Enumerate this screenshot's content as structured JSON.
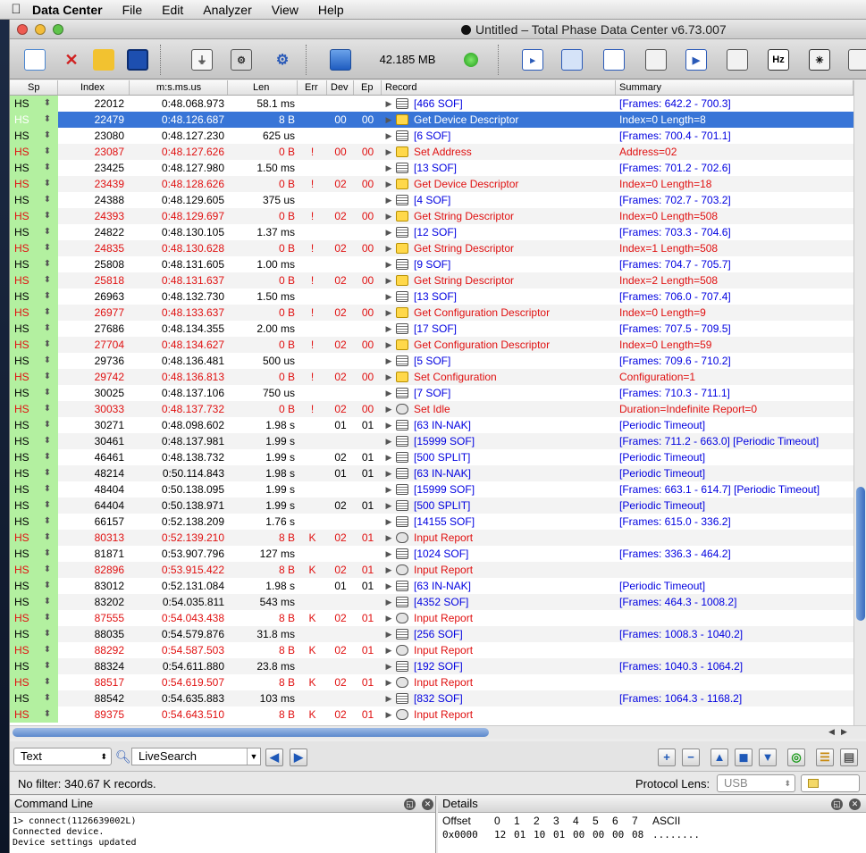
{
  "menubar": {
    "app": "Data Center",
    "items": [
      "File",
      "Edit",
      "Analyzer",
      "View",
      "Help"
    ]
  },
  "window": {
    "title": "Untitled – Total Phase Data Center v6.73.007"
  },
  "toolbar": {
    "memory": "42.185 MB",
    "hz_label": "Hz"
  },
  "columns": [
    "Sp",
    "Index",
    "m:s.ms.us",
    "Len",
    "Err",
    "Dev",
    "Ep",
    "Record",
    "Summary"
  ],
  "rows": [
    {
      "sp": "HS",
      "idx": "22012",
      "time": "0:48.068.973",
      "len": "58.1 ms",
      "err": "",
      "dev": "",
      "ep": "",
      "rec": "[466 SOF]",
      "icon": "sof",
      "sum": "[Frames: 642.2 - 700.3]",
      "red": false,
      "sel": false
    },
    {
      "sp": "HS",
      "idx": "22479",
      "time": "0:48.126.687",
      "len": "8 B",
      "err": "",
      "dev": "00",
      "ep": "00",
      "rec": "Get Device Descriptor",
      "icon": "ctrl",
      "sum": "Index=0 Length=8",
      "red": false,
      "sel": true
    },
    {
      "sp": "HS",
      "idx": "23080",
      "time": "0:48.127.230",
      "len": "625 us",
      "err": "",
      "dev": "",
      "ep": "",
      "rec": "[6 SOF]",
      "icon": "sof",
      "sum": "[Frames: 700.4 - 701.1]",
      "red": false,
      "sel": false
    },
    {
      "sp": "HS",
      "idx": "23087",
      "time": "0:48.127.626",
      "len": "0 B",
      "err": "!",
      "dev": "00",
      "ep": "00",
      "rec": "Set Address",
      "icon": "ctrl",
      "sum": "Address=02",
      "red": true,
      "sel": false
    },
    {
      "sp": "HS",
      "idx": "23425",
      "time": "0:48.127.980",
      "len": "1.50 ms",
      "err": "",
      "dev": "",
      "ep": "",
      "rec": "[13 SOF]",
      "icon": "sof",
      "sum": "[Frames: 701.2 - 702.6]",
      "red": false,
      "sel": false
    },
    {
      "sp": "HS",
      "idx": "23439",
      "time": "0:48.128.626",
      "len": "0 B",
      "err": "!",
      "dev": "02",
      "ep": "00",
      "rec": "Get Device Descriptor",
      "icon": "ctrl",
      "sum": "Index=0 Length=18",
      "red": true,
      "sel": false
    },
    {
      "sp": "HS",
      "idx": "24388",
      "time": "0:48.129.605",
      "len": "375 us",
      "err": "",
      "dev": "",
      "ep": "",
      "rec": "[4 SOF]",
      "icon": "sof",
      "sum": "[Frames: 702.7 - 703.2]",
      "red": false,
      "sel": false
    },
    {
      "sp": "HS",
      "idx": "24393",
      "time": "0:48.129.697",
      "len": "0 B",
      "err": "!",
      "dev": "02",
      "ep": "00",
      "rec": "Get String Descriptor",
      "icon": "ctrl",
      "sum": "Index=0 Length=508",
      "red": true,
      "sel": false
    },
    {
      "sp": "HS",
      "idx": "24822",
      "time": "0:48.130.105",
      "len": "1.37 ms",
      "err": "",
      "dev": "",
      "ep": "",
      "rec": "[12 SOF]",
      "icon": "sof",
      "sum": "[Frames: 703.3 - 704.6]",
      "red": false,
      "sel": false
    },
    {
      "sp": "HS",
      "idx": "24835",
      "time": "0:48.130.628",
      "len": "0 B",
      "err": "!",
      "dev": "02",
      "ep": "00",
      "rec": "Get String Descriptor",
      "icon": "ctrl",
      "sum": "Index=1 Length=508",
      "red": true,
      "sel": false
    },
    {
      "sp": "HS",
      "idx": "25808",
      "time": "0:48.131.605",
      "len": "1.00 ms",
      "err": "",
      "dev": "",
      "ep": "",
      "rec": "[9 SOF]",
      "icon": "sof",
      "sum": "[Frames: 704.7 - 705.7]",
      "red": false,
      "sel": false
    },
    {
      "sp": "HS",
      "idx": "25818",
      "time": "0:48.131.637",
      "len": "0 B",
      "err": "!",
      "dev": "02",
      "ep": "00",
      "rec": "Get String Descriptor",
      "icon": "ctrl",
      "sum": "Index=2 Length=508",
      "red": true,
      "sel": false
    },
    {
      "sp": "HS",
      "idx": "26963",
      "time": "0:48.132.730",
      "len": "1.50 ms",
      "err": "",
      "dev": "",
      "ep": "",
      "rec": "[13 SOF]",
      "icon": "sof",
      "sum": "[Frames: 706.0 - 707.4]",
      "red": false,
      "sel": false
    },
    {
      "sp": "HS",
      "idx": "26977",
      "time": "0:48.133.637",
      "len": "0 B",
      "err": "!",
      "dev": "02",
      "ep": "00",
      "rec": "Get Configuration Descriptor",
      "icon": "ctrl",
      "sum": "Index=0 Length=9",
      "red": true,
      "sel": false
    },
    {
      "sp": "HS",
      "idx": "27686",
      "time": "0:48.134.355",
      "len": "2.00 ms",
      "err": "",
      "dev": "",
      "ep": "",
      "rec": "[17 SOF]",
      "icon": "sof",
      "sum": "[Frames: 707.5 - 709.5]",
      "red": false,
      "sel": false
    },
    {
      "sp": "HS",
      "idx": "27704",
      "time": "0:48.134.627",
      "len": "0 B",
      "err": "!",
      "dev": "02",
      "ep": "00",
      "rec": "Get Configuration Descriptor",
      "icon": "ctrl",
      "sum": "Index=0 Length=59",
      "red": true,
      "sel": false
    },
    {
      "sp": "HS",
      "idx": "29736",
      "time": "0:48.136.481",
      "len": "500 us",
      "err": "",
      "dev": "",
      "ep": "",
      "rec": "[5 SOF]",
      "icon": "sof",
      "sum": "[Frames: 709.6 - 710.2]",
      "red": false,
      "sel": false
    },
    {
      "sp": "HS",
      "idx": "29742",
      "time": "0:48.136.813",
      "len": "0 B",
      "err": "!",
      "dev": "02",
      "ep": "00",
      "rec": "Set Configuration",
      "icon": "ctrl",
      "sum": "Configuration=1",
      "red": true,
      "sel": false
    },
    {
      "sp": "HS",
      "idx": "30025",
      "time": "0:48.137.106",
      "len": "750 us",
      "err": "",
      "dev": "",
      "ep": "",
      "rec": "[7 SOF]",
      "icon": "sof",
      "sum": "[Frames: 710.3 - 711.1]",
      "red": false,
      "sel": false
    },
    {
      "sp": "HS",
      "idx": "30033",
      "time": "0:48.137.732",
      "len": "0 B",
      "err": "!",
      "dev": "02",
      "ep": "00",
      "rec": "Set Idle",
      "icon": "hid",
      "sum": "Duration=Indefinite Report=0",
      "red": true,
      "sel": false
    },
    {
      "sp": "HS",
      "idx": "30271",
      "time": "0:48.098.602",
      "len": "1.98 s",
      "err": "",
      "dev": "01",
      "ep": "01",
      "rec": "[63 IN-NAK]",
      "icon": "sof",
      "sum": "[Periodic Timeout]",
      "red": false,
      "sel": false
    },
    {
      "sp": "HS",
      "idx": "30461",
      "time": "0:48.137.981",
      "len": "1.99 s",
      "err": "",
      "dev": "",
      "ep": "",
      "rec": "[15999 SOF]",
      "icon": "sof",
      "sum": "[Frames: 711.2 - 663.0] [Periodic Timeout]",
      "red": false,
      "sel": false
    },
    {
      "sp": "HS",
      "idx": "46461",
      "time": "0:48.138.732",
      "len": "1.99 s",
      "err": "",
      "dev": "02",
      "ep": "01",
      "rec": "[500 SPLIT]",
      "icon": "sof",
      "sum": "[Periodic Timeout]",
      "red": false,
      "sel": false
    },
    {
      "sp": "HS",
      "idx": "48214",
      "time": "0:50.114.843",
      "len": "1.98 s",
      "err": "",
      "dev": "01",
      "ep": "01",
      "rec": "[63 IN-NAK]",
      "icon": "sof",
      "sum": "[Periodic Timeout]",
      "red": false,
      "sel": false
    },
    {
      "sp": "HS",
      "idx": "48404",
      "time": "0:50.138.095",
      "len": "1.99 s",
      "err": "",
      "dev": "",
      "ep": "",
      "rec": "[15999 SOF]",
      "icon": "sof",
      "sum": "[Frames: 663.1 - 614.7] [Periodic Timeout]",
      "red": false,
      "sel": false
    },
    {
      "sp": "HS",
      "idx": "64404",
      "time": "0:50.138.971",
      "len": "1.99 s",
      "err": "",
      "dev": "02",
      "ep": "01",
      "rec": "[500 SPLIT]",
      "icon": "sof",
      "sum": "[Periodic Timeout]",
      "red": false,
      "sel": false
    },
    {
      "sp": "HS",
      "idx": "66157",
      "time": "0:52.138.209",
      "len": "1.76 s",
      "err": "",
      "dev": "",
      "ep": "",
      "rec": "[14155 SOF]",
      "icon": "sof",
      "sum": "[Frames: 615.0 - 336.2]",
      "red": false,
      "sel": false
    },
    {
      "sp": "HS",
      "idx": "80313",
      "time": "0:52.139.210",
      "len": "8 B",
      "err": "K",
      "dev": "02",
      "ep": "01",
      "rec": "Input Report",
      "icon": "hid",
      "sum": "",
      "red": true,
      "sel": false
    },
    {
      "sp": "HS",
      "idx": "81871",
      "time": "0:53.907.796",
      "len": "127 ms",
      "err": "",
      "dev": "",
      "ep": "",
      "rec": "[1024 SOF]",
      "icon": "sof",
      "sum": "[Frames: 336.3 - 464.2]",
      "red": false,
      "sel": false
    },
    {
      "sp": "HS",
      "idx": "82896",
      "time": "0:53.915.422",
      "len": "8 B",
      "err": "K",
      "dev": "02",
      "ep": "01",
      "rec": "Input Report",
      "icon": "hid",
      "sum": "",
      "red": true,
      "sel": false
    },
    {
      "sp": "HS",
      "idx": "83012",
      "time": "0:52.131.084",
      "len": "1.98 s",
      "err": "",
      "dev": "01",
      "ep": "01",
      "rec": "[63 IN-NAK]",
      "icon": "sof",
      "sum": "[Periodic Timeout]",
      "red": false,
      "sel": false
    },
    {
      "sp": "HS",
      "idx": "83202",
      "time": "0:54.035.811",
      "len": "543 ms",
      "err": "",
      "dev": "",
      "ep": "",
      "rec": "[4352 SOF]",
      "icon": "sof",
      "sum": "[Frames: 464.3 - 1008.2]",
      "red": false,
      "sel": false
    },
    {
      "sp": "HS",
      "idx": "87555",
      "time": "0:54.043.438",
      "len": "8 B",
      "err": "K",
      "dev": "02",
      "ep": "01",
      "rec": "Input Report",
      "icon": "hid",
      "sum": "",
      "red": true,
      "sel": false
    },
    {
      "sp": "HS",
      "idx": "88035",
      "time": "0:54.579.876",
      "len": "31.8 ms",
      "err": "",
      "dev": "",
      "ep": "",
      "rec": "[256 SOF]",
      "icon": "sof",
      "sum": "[Frames: 1008.3 - 1040.2]",
      "red": false,
      "sel": false
    },
    {
      "sp": "HS",
      "idx": "88292",
      "time": "0:54.587.503",
      "len": "8 B",
      "err": "K",
      "dev": "02",
      "ep": "01",
      "rec": "Input Report",
      "icon": "hid",
      "sum": "",
      "red": true,
      "sel": false
    },
    {
      "sp": "HS",
      "idx": "88324",
      "time": "0:54.611.880",
      "len": "23.8 ms",
      "err": "",
      "dev": "",
      "ep": "",
      "rec": "[192 SOF]",
      "icon": "sof",
      "sum": "[Frames: 1040.3 - 1064.2]",
      "red": false,
      "sel": false
    },
    {
      "sp": "HS",
      "idx": "88517",
      "time": "0:54.619.507",
      "len": "8 B",
      "err": "K",
      "dev": "02",
      "ep": "01",
      "rec": "Input Report",
      "icon": "hid",
      "sum": "",
      "red": true,
      "sel": false
    },
    {
      "sp": "HS",
      "idx": "88542",
      "time": "0:54.635.883",
      "len": "103 ms",
      "err": "",
      "dev": "",
      "ep": "",
      "rec": "[832 SOF]",
      "icon": "sof",
      "sum": "[Frames: 1064.3 - 1168.2]",
      "red": false,
      "sel": false
    },
    {
      "sp": "HS",
      "idx": "89375",
      "time": "0:54.643.510",
      "len": "8 B",
      "err": "K",
      "dev": "02",
      "ep": "01",
      "rec": "Input Report",
      "icon": "hid",
      "sum": "",
      "red": true,
      "sel": false
    }
  ],
  "filter": {
    "mode": "Text",
    "search": "LiveSearch",
    "status": "No filter: 340.67 K records.",
    "lens_label": "Protocol Lens:",
    "lens_value": "USB"
  },
  "command": {
    "title": "Command Line",
    "lines": [
      "1> connect(1126639002L)",
      "Connected device.",
      "Device settings updated"
    ]
  },
  "details": {
    "title": "Details",
    "header": [
      "Offset",
      "0",
      "1",
      "2",
      "3",
      "4",
      "5",
      "6",
      "7",
      "ASCII"
    ],
    "row": [
      "0x0000",
      "12",
      "01",
      "10",
      "01",
      "00",
      "00",
      "00",
      "08",
      "........"
    ]
  },
  "colors": {
    "selection": "#3875d7",
    "error": "#e01010",
    "link": "#0000e0",
    "speed_bg": "#b3f0a0"
  }
}
